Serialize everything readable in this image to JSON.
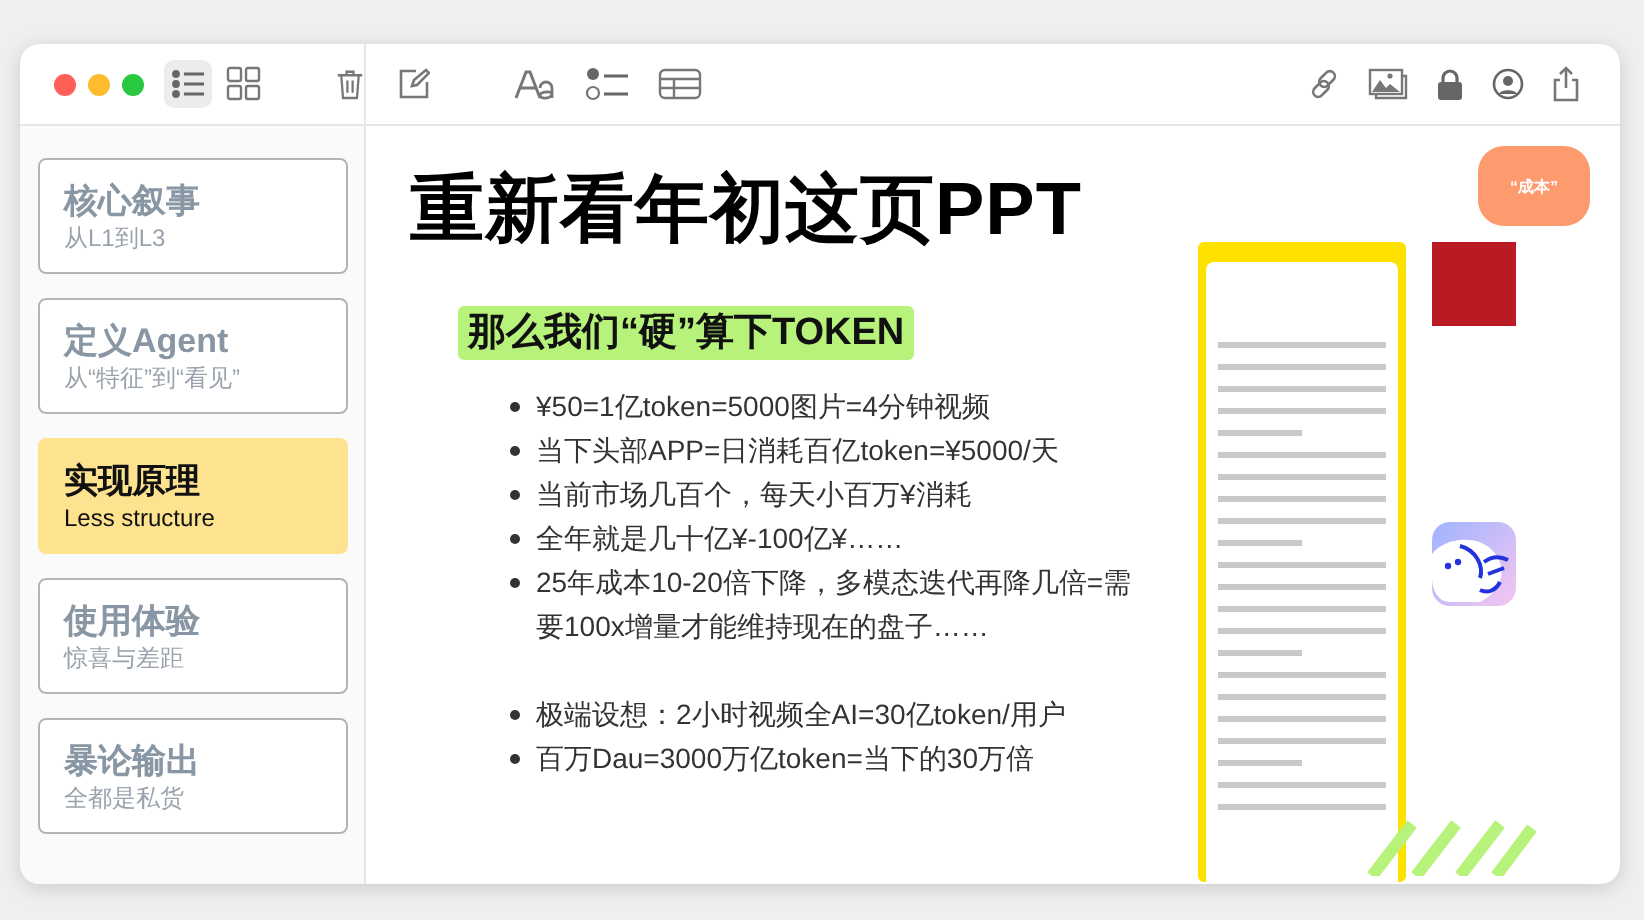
{
  "toolbar": {
    "view_buttons": [
      {
        "kind": "list",
        "selected": true
      },
      {
        "kind": "gallery",
        "selected": false
      }
    ]
  },
  "sidebar": {
    "items": [
      {
        "title": "核心叙事",
        "subtitle": "从L1到L3",
        "selected": false
      },
      {
        "title": "定义Agent",
        "subtitle": "从“特征”到“看见”",
        "selected": false
      },
      {
        "title": "实现原理",
        "subtitle": "Less structure",
        "selected": true
      },
      {
        "title": "使用体验",
        "subtitle": "惊喜与差距",
        "selected": false
      },
      {
        "title": "暴论输出",
        "subtitle": "全都是私货",
        "selected": false
      }
    ]
  },
  "slide": {
    "title": "重新看年初这页PPT",
    "highlight": "那么我们“硬”算下TOKEN",
    "bullet_groups": [
      [
        "¥50=1亿token=5000图片=4分钟视频",
        "当下头部APP=日消耗百亿token=¥5000/天",
        "当前市场几百个，每天小百万¥消耗",
        "全年就是几十亿¥-100亿¥……",
        "25年成本10-20倍下降，多模态迭代再降几倍=需要100x增量才能维持现在的盘子……"
      ],
      [
        "极端设想：2小时视频全AI=30亿token/用户",
        "百万Dau=3000万亿token=当下的30万倍"
      ]
    ],
    "tag": "“成本”"
  }
}
